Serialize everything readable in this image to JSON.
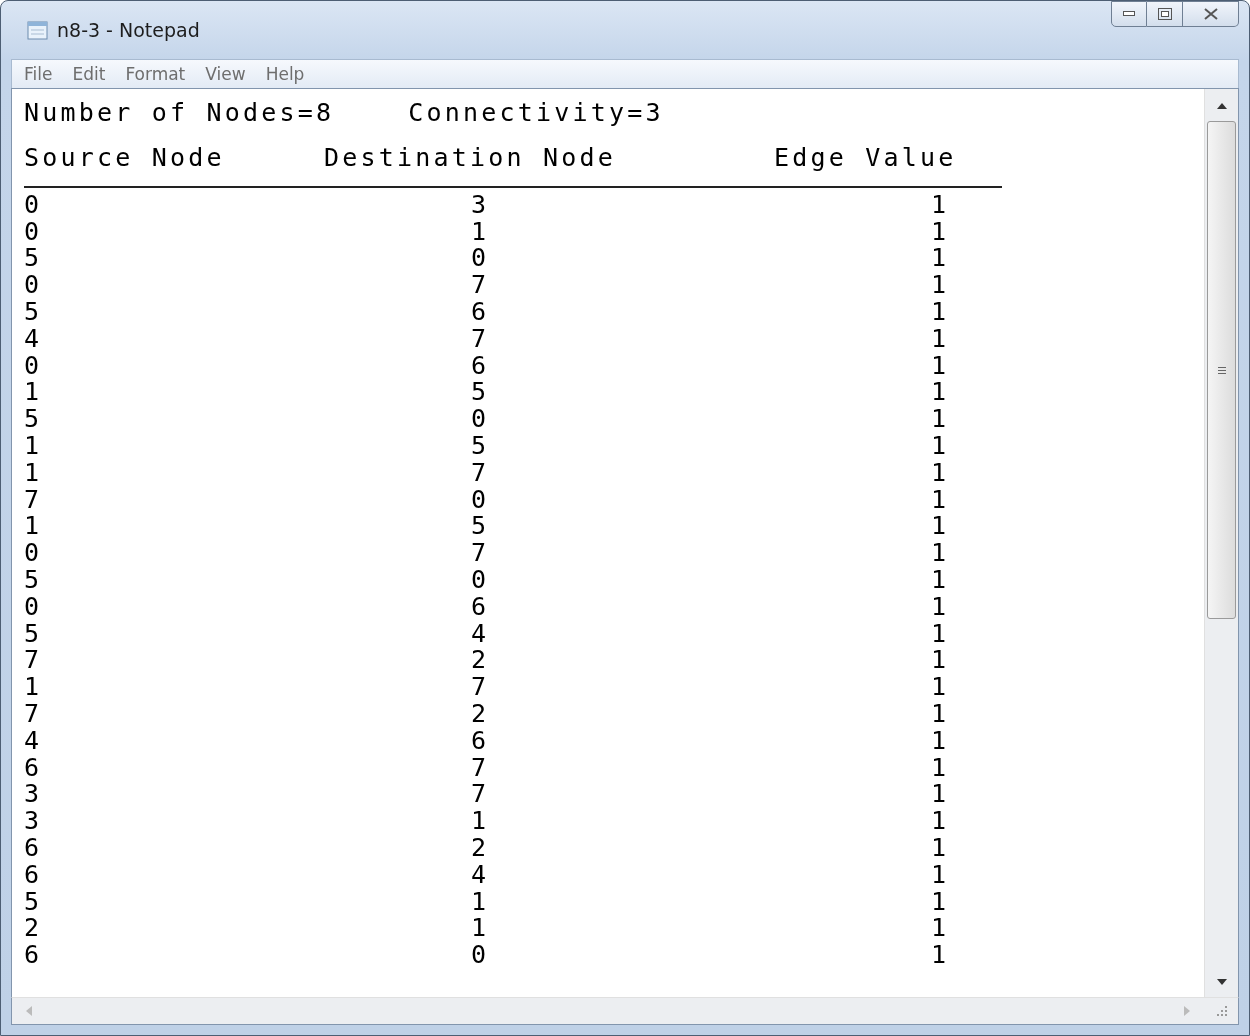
{
  "window": {
    "title": "n8-3 - Notepad"
  },
  "menu": [
    "File",
    "Edit",
    "Format",
    "View",
    "Help"
  ],
  "document": {
    "summary": [
      "Number of Nodes=8",
      "Connectivity=3"
    ],
    "columns": [
      "Source Node",
      "Destination Node",
      "Edge Value"
    ],
    "rows": [
      [
        "0",
        "3",
        "1"
      ],
      [
        "0",
        "1",
        "1"
      ],
      [
        "5",
        "0",
        "1"
      ],
      [
        "0",
        "7",
        "1"
      ],
      [
        "5",
        "6",
        "1"
      ],
      [
        "4",
        "7",
        "1"
      ],
      [
        "0",
        "6",
        "1"
      ],
      [
        "1",
        "5",
        "1"
      ],
      [
        "5",
        "0",
        "1"
      ],
      [
        "1",
        "5",
        "1"
      ],
      [
        "1",
        "7",
        "1"
      ],
      [
        "7",
        "0",
        "1"
      ],
      [
        "1",
        "5",
        "1"
      ],
      [
        "0",
        "7",
        "1"
      ],
      [
        "5",
        "0",
        "1"
      ],
      [
        "0",
        "6",
        "1"
      ],
      [
        "5",
        "4",
        "1"
      ],
      [
        "7",
        "2",
        "1"
      ],
      [
        "1",
        "7",
        "1"
      ],
      [
        "7",
        "2",
        "1"
      ],
      [
        "4",
        "6",
        "1"
      ],
      [
        "6",
        "7",
        "1"
      ],
      [
        "3",
        "7",
        "1"
      ],
      [
        "3",
        "1",
        "1"
      ],
      [
        "6",
        "2",
        "1"
      ],
      [
        "6",
        "4",
        "1"
      ],
      [
        "5",
        "1",
        "1"
      ],
      [
        "2",
        "1",
        "1"
      ],
      [
        "6",
        "0",
        "1"
      ]
    ]
  }
}
